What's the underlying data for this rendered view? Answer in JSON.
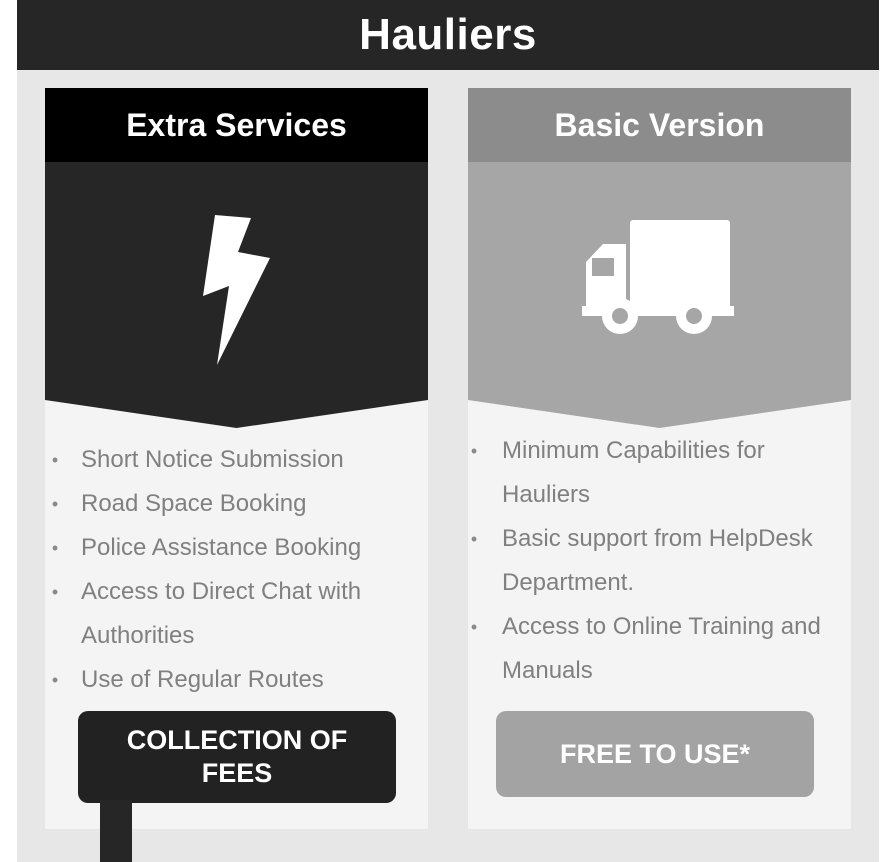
{
  "title": "Hauliers",
  "colors": {
    "dark_bar": "#262626",
    "background": "#e7e7e7",
    "card_bg": "#f4f4f4",
    "extra_header": "#000000",
    "basic_header": "#8c8c8c",
    "basic_hero": "#a6a6a6",
    "text_gray": "#808080"
  },
  "extra": {
    "heading": "Extra Services",
    "icon": "lightning-bolt-icon",
    "features": [
      "Short Notice Submission",
      "Road Space Booking",
      "Police Assistance Booking",
      "Access to Direct Chat with",
      "Authorities",
      "Use of Regular Routes"
    ],
    "cta_line1": "COLLECTION OF",
    "cta_line2": "FEES"
  },
  "basic": {
    "heading": "Basic Version",
    "icon": "truck-icon",
    "features": [
      "Minimum Capabilities for",
      "Hauliers",
      "Basic support from HelpDesk",
      "Department.",
      "Access to Online Training and",
      "Manuals"
    ],
    "cta": "FREE TO USE*"
  }
}
